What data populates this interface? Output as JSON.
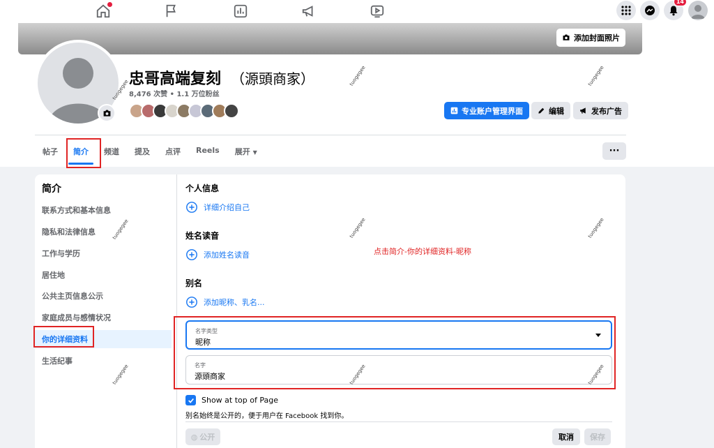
{
  "top_nav": {
    "icons": [
      "home-icon",
      "flag-icon",
      "insights-icon",
      "megaphone-icon",
      "video-icon"
    ],
    "notification_count": "14"
  },
  "header": {
    "cover_button_label": "添加封面照片",
    "page_name": "忠哥高端复刻",
    "page_name_suffix": "（源頭商家）",
    "stats": "8,476 次赞 • 1.1 万位粉丝",
    "buttons": {
      "pro_dashboard": "专业账户管理界面",
      "edit": "编辑",
      "advertise": "发布广告"
    },
    "tabs": [
      {
        "label": "帖子"
      },
      {
        "label": "简介"
      },
      {
        "label": "频道"
      },
      {
        "label": "提及"
      },
      {
        "label": "点评"
      },
      {
        "label": "Reels"
      },
      {
        "label": "展开"
      }
    ],
    "more_label": "···"
  },
  "about": {
    "title": "简介",
    "nav_items": [
      {
        "label": "联系方式和基本信息"
      },
      {
        "label": "隐私和法律信息"
      },
      {
        "label": "工作与学历"
      },
      {
        "label": "居住地"
      },
      {
        "label": "公共主页信息公示"
      },
      {
        "label": "家庭成员与感情状况"
      },
      {
        "label": "你的详细资料"
      },
      {
        "label": "生活纪事"
      }
    ],
    "sections": {
      "personal_info_title": "个人信息",
      "personal_info_link": "详细介绍自己",
      "name_pronunciation_title": "姓名读音",
      "name_pronunciation_link": "添加姓名读音",
      "nickname_title": "别名",
      "nickname_link": "添加昵称、乳名..."
    },
    "name_type_field": {
      "label": "名字类型",
      "value": "昵称"
    },
    "name_field": {
      "label": "名字",
      "value": "源頭商家"
    },
    "checkbox_label": "Show at top of Page",
    "hint": "别名始终是公开的，便于用户在 Facebook 找到你。",
    "public_button": "公开",
    "cancel_button": "取消",
    "save_button": "保存"
  },
  "annotation_text": "点击简介-你的详细资料-昵称",
  "watermark": "tuogegee",
  "colors": {
    "accent": "#1877f2",
    "annotation": "#e02424"
  }
}
